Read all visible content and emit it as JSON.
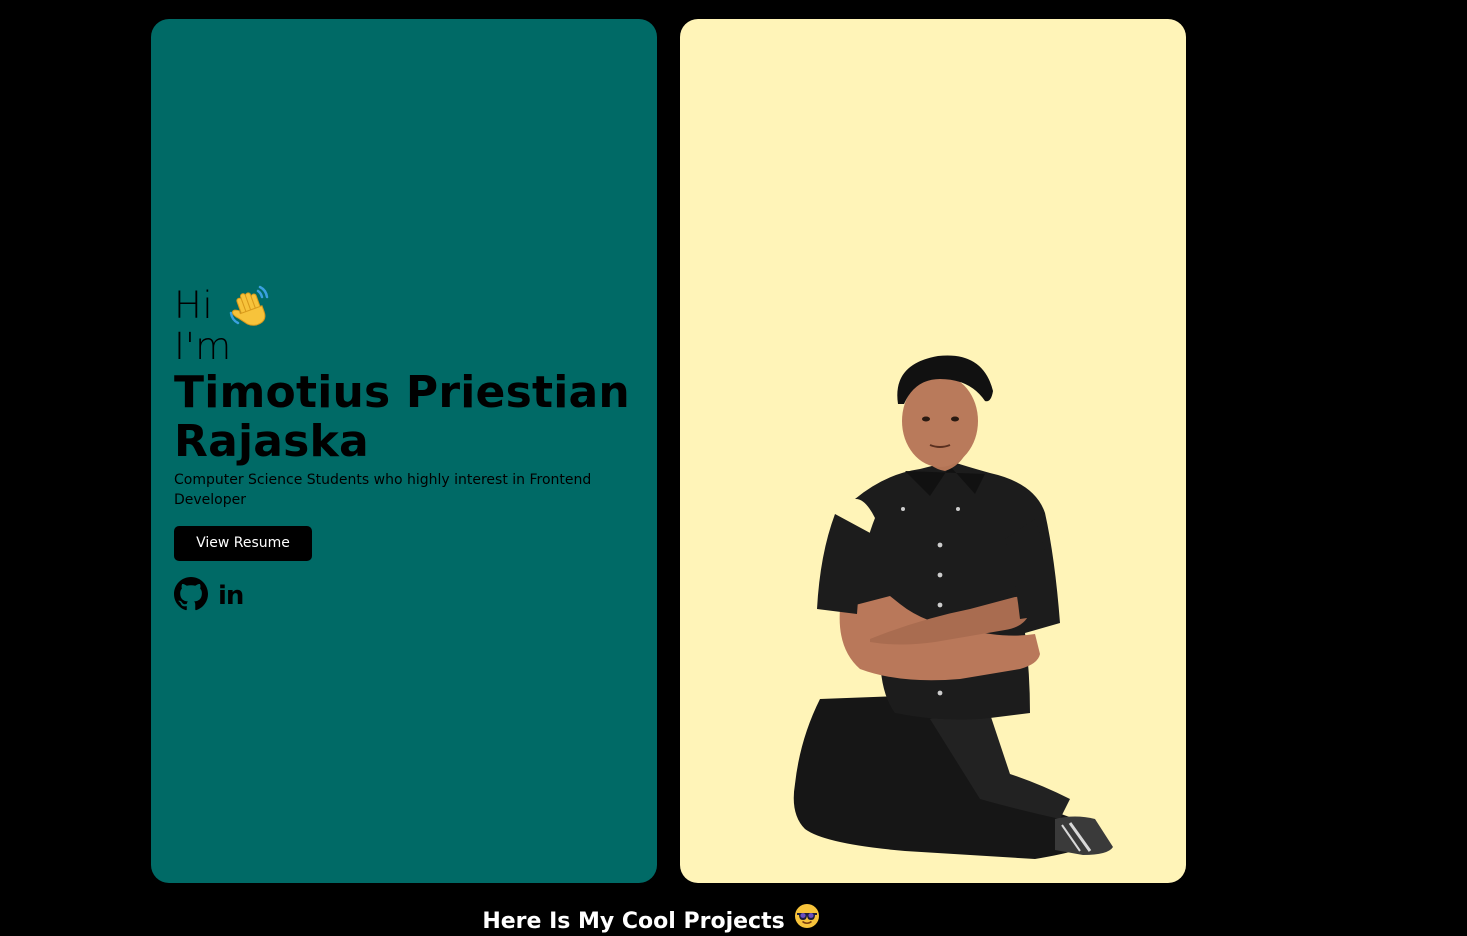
{
  "hero": {
    "greeting": "Hi",
    "im": "I'm",
    "name": "Timotius Priestian Rajaska",
    "tagline": "Computer Science Students who highly interest in Frontend Developer",
    "resume_button": "View Resume",
    "social_icons": [
      "github-icon",
      "linkedin-icon"
    ],
    "linkedin_text": "in"
  },
  "colors": {
    "left_card": "#006a66",
    "right_card": "#fff4b8",
    "background": "#000000"
  },
  "projects": {
    "heading": "Here Is My Cool Projects"
  }
}
